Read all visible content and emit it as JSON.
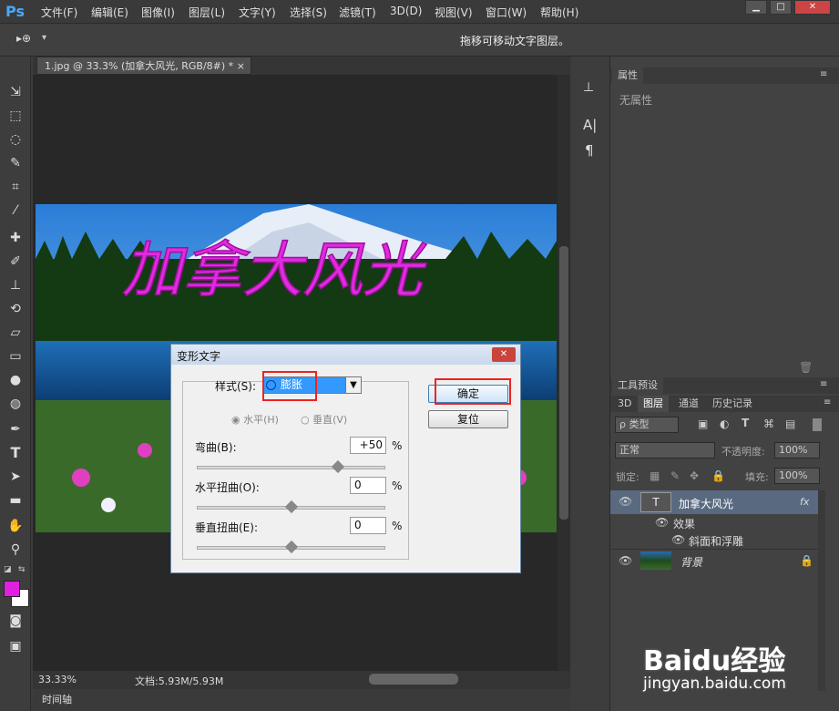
{
  "app": {
    "logo": "Ps"
  },
  "menu": [
    "文件(F)",
    "编辑(E)",
    "图像(I)",
    "图层(L)",
    "文字(Y)",
    "选择(S)",
    "滤镜(T)",
    "3D(D)",
    "视图(V)",
    "窗口(W)",
    "帮助(H)"
  ],
  "window_controls": {
    "minimize": "▁",
    "restore": "□",
    "close": "✕"
  },
  "options": {
    "tool_icon": "▸⊕",
    "hint": "拖移可移动文字图层。"
  },
  "document": {
    "tab": "1.jpg @ 33.3% (加拿大风光, RGB/8#) *",
    "tab_close": "×",
    "photo_text": "加拿大风光"
  },
  "status": {
    "zoom": "33.33%",
    "doc_info": "文档:5.93M/5.93M"
  },
  "timeline": "时间轴",
  "dialog": {
    "title": "变形文字",
    "style_label": "样式(S):",
    "style_value": "膨胀",
    "orientation_h": "水平(H)",
    "orientation_v": "垂直(V)",
    "bend_label": "弯曲(B):",
    "bend_value": "+50",
    "hdist_label": "水平扭曲(O):",
    "hdist_value": "0",
    "vdist_label": "垂直扭曲(E):",
    "vdist_value": "0",
    "percent": "%",
    "ok_button": "确定",
    "reset_button": "复位",
    "close": "✕"
  },
  "properties": {
    "tab": "属性",
    "empty": "无属性"
  },
  "tool_presets": {
    "tab": "工具预设"
  },
  "layers": {
    "tabs": [
      "3D",
      "图层",
      "通道",
      "历史记录"
    ],
    "filter_kind": "ρ 类型",
    "blend_mode": "正常",
    "opacity_label": "不透明度:",
    "opacity_value": "100%",
    "lock_label": "锁定:",
    "fill_label": "填充:",
    "fill_value": "100%",
    "items": [
      {
        "name": "加拿大风光",
        "thumb": "T",
        "fx": "fx"
      },
      {
        "name": "效果"
      },
      {
        "name": "斜面和浮雕"
      },
      {
        "name": "背景"
      }
    ]
  },
  "watermark": {
    "brand": "Baidu经验",
    "url": "jingyan.baidu.com"
  },
  "colors": {
    "accent": "#3d8ee8",
    "foreground": "#e020e0",
    "highlight": "#e22222"
  }
}
